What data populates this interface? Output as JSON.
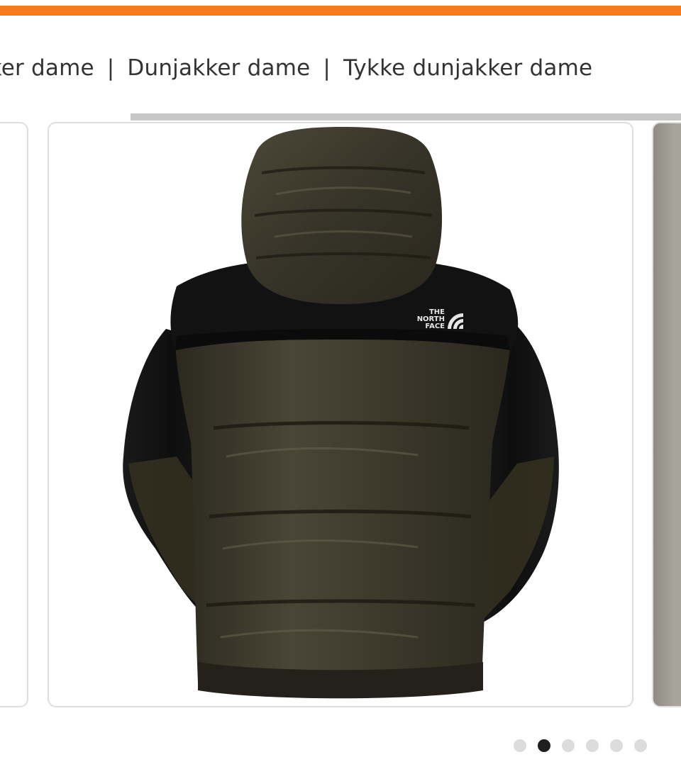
{
  "breadcrumb": {
    "items": [
      "Jakker dame",
      "Dunjakker dame",
      "Tykke dunjakker dame"
    ],
    "separator": "|"
  },
  "carousel": {
    "slide_count": 6,
    "active_index": 1,
    "main_image": {
      "subject": "black-brown hooded puffer down jacket, back view",
      "logo_text": [
        "THE",
        "NORTH",
        "FACE"
      ]
    }
  },
  "colors": {
    "accent": "#f47b20",
    "dot_active": "#1e1e1e",
    "dot_inactive": "#dcdcdc",
    "jacket_brown": "#3d3a2c",
    "jacket_black": "#141414"
  }
}
